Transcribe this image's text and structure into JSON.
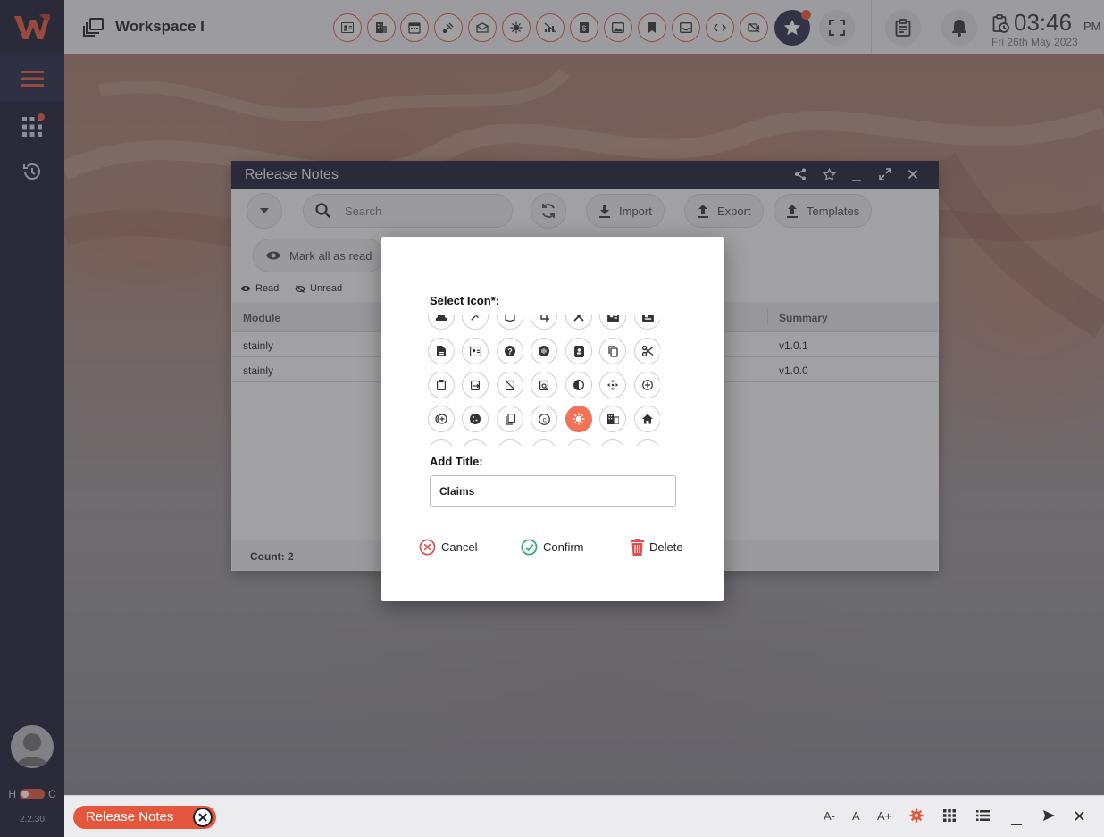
{
  "app": {
    "logo_text": "W",
    "version": "2.2.30",
    "hc_left": "H",
    "hc_right": "C"
  },
  "header": {
    "workspace_title": "Workspace I",
    "toolbar_icons": [
      "contact-card-icon",
      "building-icon",
      "calendar-icon",
      "satellite-icon",
      "envelope-icon",
      "virus-icon",
      "no-signal-icon",
      "wallet-icon",
      "image-icon",
      "bookmark-icon",
      "inbox-icon",
      "code-icon",
      "no-video-icon"
    ],
    "time": "03:46",
    "ampm": "PM",
    "date": "Fri 26th May 2023"
  },
  "window": {
    "title": "Release Notes",
    "search_placeholder": "Search",
    "import_label": "Import",
    "export_label": "Export",
    "templates_label": "Templates",
    "mark_all_label": "Mark all as read",
    "read_label": "Read",
    "unread_label": "Unread",
    "columns": {
      "module": "Module",
      "summary": "Summary"
    },
    "rows": [
      {
        "module": "stainly",
        "summary": "v1.0.1"
      },
      {
        "module": "stainly",
        "summary": "v1.0.0"
      }
    ],
    "count_label": "Count: 2"
  },
  "modal": {
    "select_icon_label": "Select Icon*:",
    "add_title_label": "Add Title:",
    "title_value": "Claims",
    "cancel_label": "Cancel",
    "confirm_label": "Confirm",
    "delete_label": "Delete",
    "selected_icon": "virus-icon"
  },
  "taskbar": {
    "tab_label": "Release Notes",
    "font_small": "A-",
    "font_normal": "A",
    "font_large": "A+"
  },
  "colors": {
    "accent": "#e4573d",
    "sidebar": "#1c1d33",
    "confirm": "#2aa876",
    "cancel": "#e14c4c"
  }
}
